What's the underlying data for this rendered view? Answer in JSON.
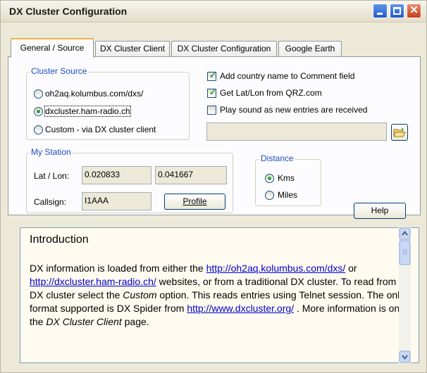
{
  "window": {
    "title": "DX Cluster Configuration"
  },
  "tabs": [
    {
      "label": "General / Source",
      "active": true
    },
    {
      "label": "DX Cluster Client",
      "active": false
    },
    {
      "label": "DX Cluster Configuration",
      "active": false
    },
    {
      "label": "Google Earth",
      "active": false
    }
  ],
  "cluster_source": {
    "label": "Cluster Source",
    "options": [
      {
        "label": "oh2aq.kolumbus.com/dxs/",
        "selected": false
      },
      {
        "label": "dxcluster.ham-radio.ch",
        "selected": true
      },
      {
        "label": "Custom - via DX cluster client",
        "selected": false
      }
    ]
  },
  "options": {
    "add_country": "Add country name to Comment field",
    "get_latlon": "Get Lat/Lon from QRZ.com",
    "play_sound": "Play sound as new entries are received",
    "sound_file_value": ""
  },
  "my_station": {
    "label": "My Station",
    "latlon_label": "Lat / Lon:",
    "lat": "0.020833",
    "lon": "0.041667",
    "callsign_label": "Callsign:",
    "callsign": "I1AAA",
    "profile_button": "Profile"
  },
  "distance": {
    "label": "Distance",
    "kms": "Kms",
    "miles": "Miles",
    "selected": "Kms"
  },
  "help_button": "Help",
  "intro": {
    "title": "Introduction",
    "p1": "DX information is loaded from either the ",
    "link1": "http://oh2aq.kolumbus.com/dxs/",
    "p2": " or ",
    "link2": "http://dxcluster.ham-radio.ch/",
    "p3": " websites, or from a traditional DX cluster. To read from a DX cluster select the ",
    "custom": "Custom",
    "p4": " option. This reads entries using Telnet session. The only format supported is DX Spider from ",
    "link3": "http://www.dxcluster.org/",
    "p5": " . More information is on the ",
    "client": "DX Cluster Client",
    "p6": " page."
  },
  "colors": {
    "accent": "#1d4fc1",
    "link": "#0000cc",
    "tab_highlight": "#f2b24a"
  }
}
